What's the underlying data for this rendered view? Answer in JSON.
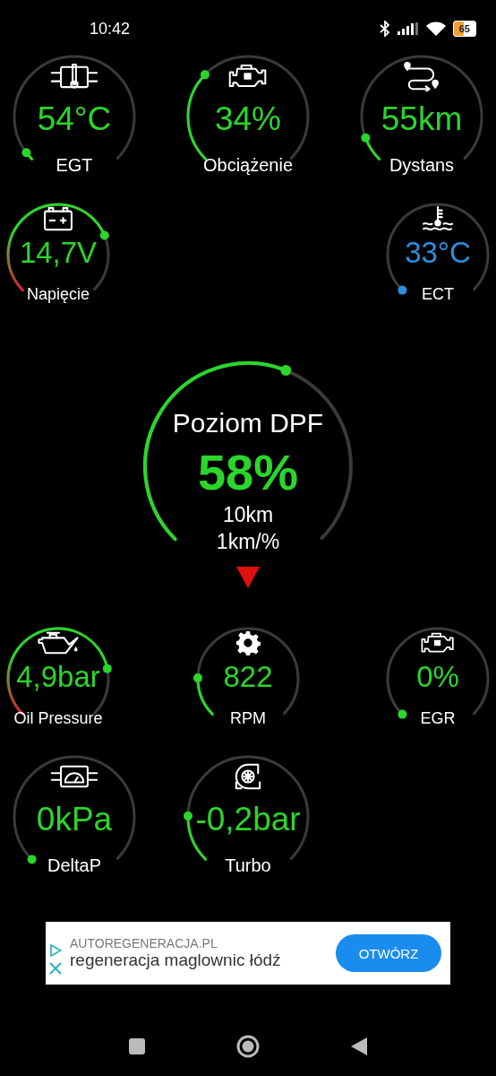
{
  "status_bar": {
    "time": "10:42",
    "battery": "65"
  },
  "upper_rows": [
    {
      "gauges": [
        {
          "label": "EGT",
          "value": "54°C",
          "color": "#2bd62b",
          "kind": "plain"
        },
        {
          "label": "Obciążenie",
          "value": "34%",
          "color": "#2bd62b",
          "kind": "plain"
        },
        {
          "label": "Dystans",
          "value": "55km",
          "color": "#2bd62b",
          "kind": "plain"
        }
      ]
    },
    {
      "gauges": [
        {
          "label": "Napięcie",
          "value": "14,7V",
          "color": "#2bd62b",
          "kind": "gradient"
        },
        {
          "label": "ECT",
          "value": "33°C",
          "color": "#2a8ee0",
          "kind": "plain"
        }
      ]
    }
  ],
  "dpf": {
    "title": "Poziom DPF",
    "value": "58%",
    "distance": "10km",
    "rate": "1km/%",
    "color": "#2bd62b"
  },
  "lower_rows": [
    {
      "gauges": [
        {
          "label": "Oil Pressure",
          "value": "4,9bar",
          "color": "#2bd62b",
          "kind": "gradient"
        },
        {
          "label": "RPM",
          "value": "822",
          "color": "#2bd62b",
          "kind": "plain"
        },
        {
          "label": "EGR",
          "value": "0%",
          "color": "#2bd62b",
          "kind": "plain"
        }
      ]
    },
    {
      "gauges": [
        {
          "label": "DeltaP",
          "value": "0kPa",
          "color": "#2bd62b",
          "kind": "plain"
        },
        {
          "label": "Turbo",
          "value": "-0,2bar",
          "color": "#2bd62b",
          "kind": "plain"
        }
      ]
    }
  ],
  "ad": {
    "domain": "AUTOREGENERACJA.PL",
    "headline": "regeneracja maglownic łódź",
    "button": "OTWÓRZ"
  }
}
